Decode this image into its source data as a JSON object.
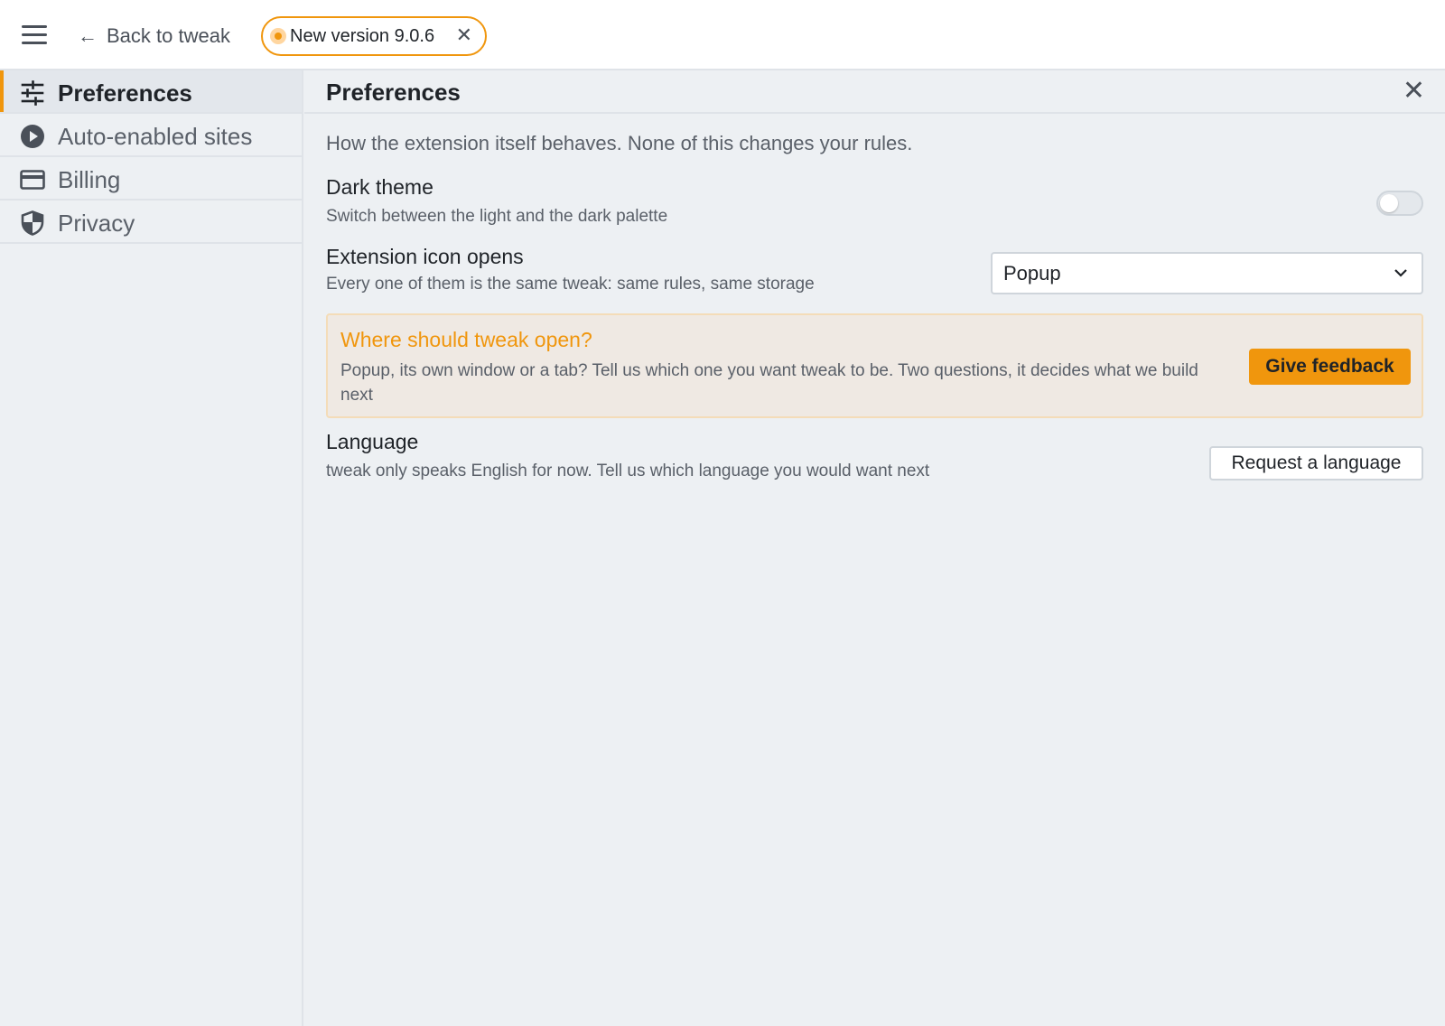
{
  "topbar": {
    "menu_icon": "hamburger-menu-icon",
    "back_arrow": "←",
    "back_label": "Back to tweak",
    "version_label": "New version 9.0.6",
    "version_close": "✕"
  },
  "sidebar": {
    "items": [
      {
        "label": "Preferences",
        "icon": "sliders-icon",
        "active": true
      },
      {
        "label": "Auto-enabled sites",
        "icon": "play-circle-icon",
        "active": false
      },
      {
        "label": "Billing",
        "icon": "credit-card-icon",
        "active": false
      },
      {
        "label": "Privacy",
        "icon": "shield-icon",
        "active": false
      }
    ]
  },
  "main": {
    "title": "Preferences",
    "close": "✕",
    "intro": "How the extension itself behaves. None of this changes your rules.",
    "dark_theme": {
      "title": "Dark theme",
      "desc": "Switch between the light and the dark palette",
      "enabled": false
    },
    "icon_opens": {
      "title": "Extension icon opens",
      "desc": "Every one of them is the same tweak: same rules, same storage",
      "selected": "Popup"
    },
    "callout": {
      "title": "Where should tweak open?",
      "text": "Popup, its own window or a tab? Tell us which one you want tweak to be. Two questions, it decides what we build next",
      "button": "Give feedback"
    },
    "language": {
      "title": "Language",
      "desc": "tweak only speaks English for now. Tell us which language you would want next",
      "button": "Request a language"
    }
  },
  "colors": {
    "accent": "#f0960d",
    "background": "#edf0f3",
    "topbar": "#ffffff",
    "text": "#1f2328",
    "muted": "#5a6069"
  }
}
